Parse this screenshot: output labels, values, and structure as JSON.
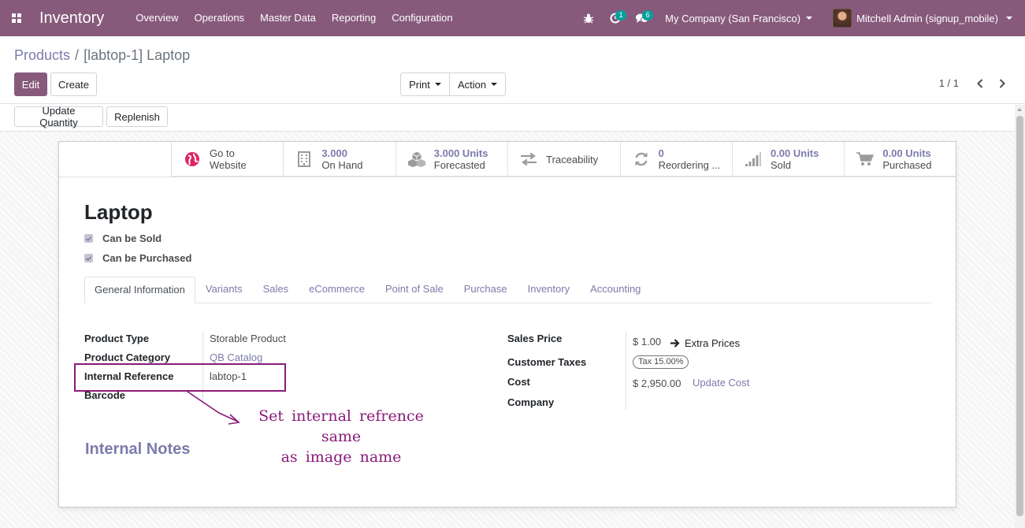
{
  "navbar": {
    "app_title": "Inventory",
    "menu": [
      "Overview",
      "Operations",
      "Master Data",
      "Reporting",
      "Configuration"
    ],
    "activity_count": "1",
    "messages_count": "6",
    "company": "My Company (San Francisco)",
    "user": "Mitchell Admin (signup_mobile)"
  },
  "breadcrumb": {
    "parent": "Products",
    "separator": "/",
    "current": "[labtop-1] Laptop"
  },
  "buttons": {
    "edit": "Edit",
    "create": "Create",
    "print": "Print",
    "action": "Action",
    "update_quantity": "Update Quantity",
    "replenish": "Replenish"
  },
  "pager": {
    "counter": "1 / 1"
  },
  "smart_buttons": [
    {
      "value": "Go to",
      "label": "Website",
      "icon": "globe-icon"
    },
    {
      "value": "3.000",
      "label": "On Hand",
      "icon": "building-icon"
    },
    {
      "value": "3.000 Units",
      "label": "Forecasted",
      "icon": "cubes-icon"
    },
    {
      "value": "",
      "label": "Traceability",
      "icon": "exchange-icon"
    },
    {
      "value": "0",
      "label": "Reordering ...",
      "icon": "refresh-icon"
    },
    {
      "value": "0.00 Units",
      "label": "Sold",
      "icon": "signal-icon"
    },
    {
      "value": "0.00 Units",
      "label": "Purchased",
      "icon": "cart-icon"
    }
  ],
  "product": {
    "name": "Laptop",
    "can_be_sold": "Can be Sold",
    "can_be_purchased": "Can be Purchased"
  },
  "tabs": [
    "General Information",
    "Variants",
    "Sales",
    "eCommerce",
    "Point of Sale",
    "Purchase",
    "Inventory",
    "Accounting"
  ],
  "general": {
    "product_type_label": "Product Type",
    "product_type": "Storable Product",
    "product_category_label": "Product Category",
    "product_category": "QB Catalog",
    "internal_reference_label": "Internal Reference",
    "internal_reference": "labtop-1",
    "barcode_label": "Barcode",
    "sales_price_label": "Sales Price",
    "sales_price": "$ 1.00",
    "extra_prices": "Extra Prices",
    "customer_taxes_label": "Customer Taxes",
    "customer_tax": "Tax 15.00%",
    "cost_label": "Cost",
    "cost": "$ 2,950.00",
    "update_cost": "Update Cost",
    "company_label": "Company",
    "internal_notes": "Internal Notes"
  },
  "annotation": {
    "line1": "Set internal refrence same",
    "line2": "as image name",
    "color": "#8a1b7a"
  },
  "colors": {
    "primary": "#875a7b",
    "link": "#7c7bad"
  }
}
